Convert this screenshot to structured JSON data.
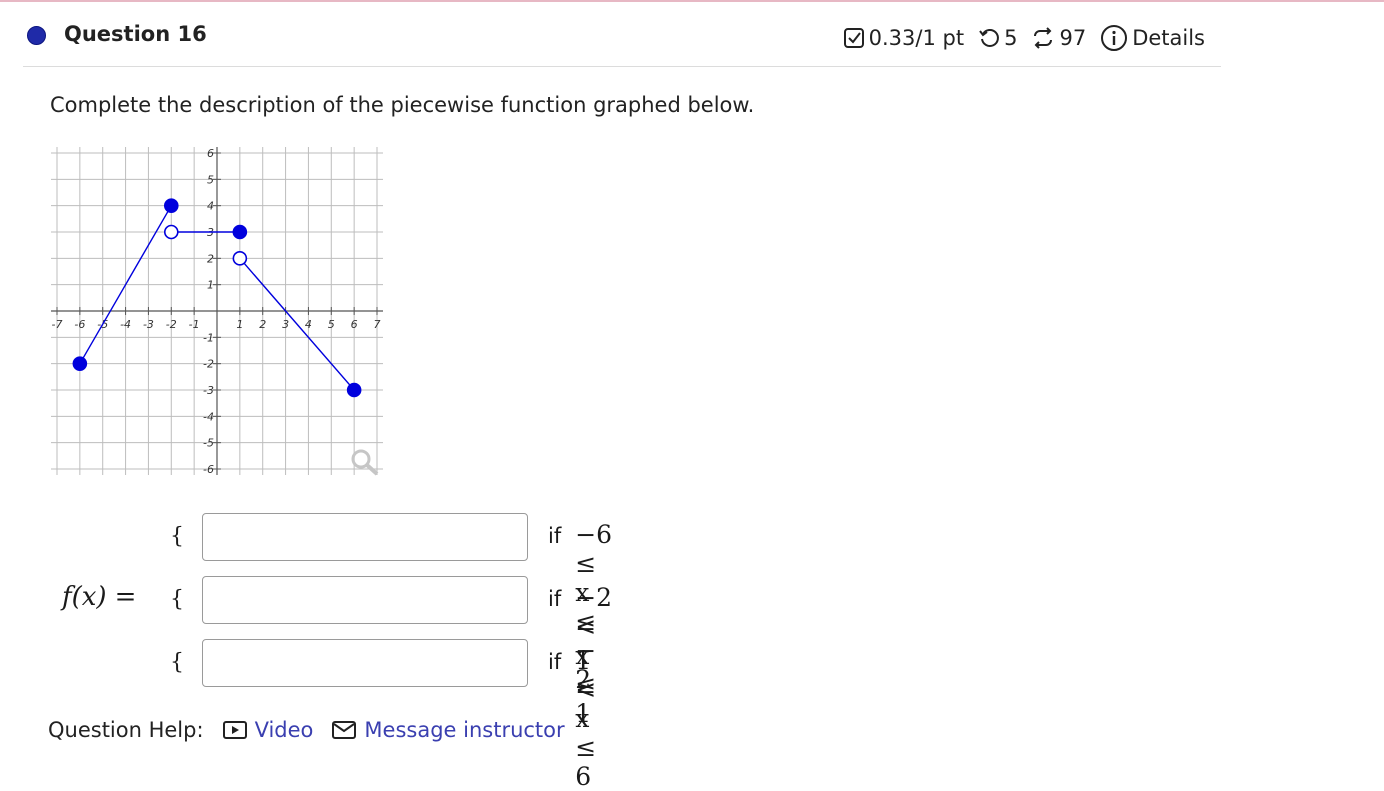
{
  "question": {
    "title": "Question 16",
    "score": "0.33/1 pt",
    "retries": "5",
    "attempts": "97",
    "details_label": "Details"
  },
  "prompt": "Complete the description of the piecewise function graphed below.",
  "graph": {
    "x_range": [
      -7,
      7
    ],
    "y_range": [
      -6,
      6
    ],
    "x_ticks": [
      "-7",
      "-6",
      "-5",
      "-4",
      "-3",
      "-2",
      "-1",
      "1",
      "2",
      "3",
      "4",
      "5",
      "6",
      "7"
    ],
    "y_ticks": [
      "6",
      "5",
      "4",
      "3",
      "2",
      "1",
      "-1",
      "-2",
      "-3",
      "-4",
      "-5",
      "-6"
    ],
    "line_color": "#0000dd",
    "segments": [
      {
        "from": [
          -6,
          -2
        ],
        "to": [
          -2,
          4
        ],
        "start": "closed",
        "end": "closed"
      },
      {
        "from": [
          -2,
          3
        ],
        "to": [
          1,
          3
        ],
        "start": "open",
        "end": "closed"
      },
      {
        "from": [
          1,
          2
        ],
        "to": [
          6,
          -3
        ],
        "start": "open",
        "end": "closed"
      }
    ]
  },
  "piecewise": {
    "lhs": "f(x)",
    "eq": "=",
    "brace": "{",
    "if_label": "if",
    "conditions": [
      "−6 ≤ x ≤ − 2",
      "−2 < x ≤ 1",
      "1 < x ≤ 6"
    ],
    "answers": [
      "",
      "",
      ""
    ]
  },
  "help": {
    "label": "Question Help:",
    "video": "Video",
    "message": "Message instructor"
  },
  "colors": {
    "accent": "#1f2aa8",
    "link": "#3a3fb0",
    "header_rule": "#e7b8c4"
  }
}
